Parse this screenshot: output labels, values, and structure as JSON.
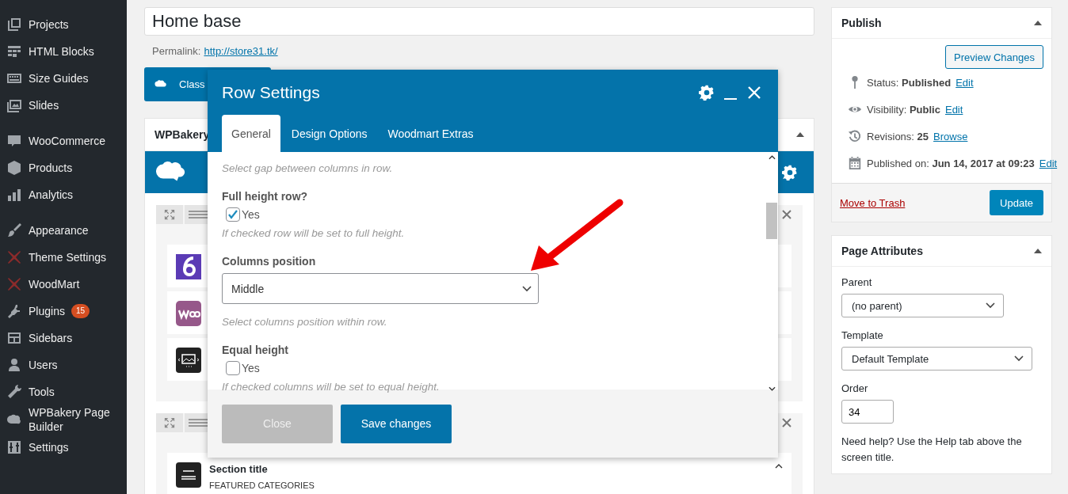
{
  "sidebar": {
    "groups": [
      {
        "items": [
          {
            "label": "Projects"
          },
          {
            "label": "HTML Blocks"
          },
          {
            "label": "Size Guides"
          },
          {
            "label": "Slides"
          }
        ]
      },
      {
        "items": [
          {
            "label": "WooCommerce"
          },
          {
            "label": "Products"
          },
          {
            "label": "Analytics"
          }
        ]
      },
      {
        "items": [
          {
            "label": "Appearance"
          },
          {
            "label": "Theme Settings"
          },
          {
            "label": "WoodMart"
          },
          {
            "label": "Plugins",
            "badge": "15"
          },
          {
            "label": "Sidebars"
          },
          {
            "label": "Users"
          },
          {
            "label": "Tools"
          },
          {
            "label": "WPBakery Page Builder"
          },
          {
            "label": "Settings"
          }
        ]
      }
    ]
  },
  "editor": {
    "title_value": "Home base",
    "permalink_label": "Permalink:",
    "permalink": "http://store31.tk/",
    "mode_button": "Class"
  },
  "builder": {
    "title": "WPBakery",
    "rows": [
      {
        "elements": [
          {
            "kind": "counter"
          },
          {
            "kind": "woo"
          },
          {
            "kind": "image"
          }
        ]
      },
      {
        "elements": [
          {
            "kind": "title",
            "title": "Section title",
            "subtitle": "FEATURED CATEGORIES"
          }
        ]
      }
    ]
  },
  "modal": {
    "title": "Row Settings",
    "tabs": [
      {
        "label": "General",
        "selected": true
      },
      {
        "label": "Design Options",
        "selected": false
      },
      {
        "label": "Woodmart Extras",
        "selected": false
      }
    ],
    "fields": [
      {
        "kind": "hint",
        "hint": "Select gap between columns in row."
      },
      {
        "kind": "checkbox",
        "label": "Full height row?",
        "option": "Yes",
        "checked": true,
        "hint": "If checked row will be set to full height."
      },
      {
        "kind": "select",
        "label": "Columns position",
        "value": "Middle",
        "hint": "Select columns position within row."
      },
      {
        "kind": "checkbox",
        "label": "Equal height",
        "option": "Yes",
        "checked": false,
        "hint": "If checked columns will be set to equal height."
      }
    ],
    "buttons": [
      {
        "label": "Close",
        "disabled": true
      },
      {
        "label": "Save changes",
        "disabled": false
      }
    ]
  },
  "publish": {
    "title": "Publish",
    "preview_button": "Preview Changes",
    "rows": [
      {
        "kind": "status",
        "label": "Status:",
        "value": "Published",
        "link": "Edit"
      },
      {
        "kind": "visibility",
        "label": "Visibility:",
        "value": "Public",
        "link": "Edit"
      },
      {
        "kind": "revisions",
        "label": "Revisions:",
        "value": "25",
        "link": "Browse"
      },
      {
        "kind": "date",
        "label": "Published on:",
        "value": "Jun 14, 2017 at 09:23",
        "link": "Edit"
      }
    ],
    "trash_link": "Move to Trash",
    "update_button": "Update"
  },
  "page_attributes": {
    "title": "Page Attributes",
    "parent_label": "Parent",
    "parent_value": "(no parent)",
    "template_label": "Template",
    "template_value": "Default Template",
    "order_label": "Order",
    "order_value": "34",
    "help": "Need help? Use the Help tab above the screen title."
  }
}
